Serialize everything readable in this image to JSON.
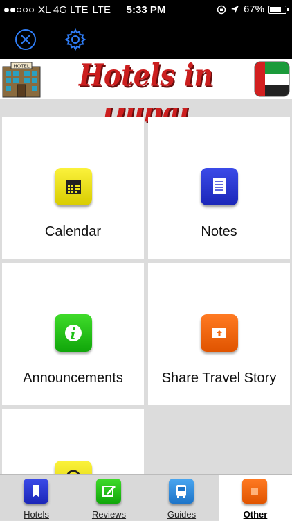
{
  "status_bar": {
    "carrier": "XL 4G LTE",
    "network": "LTE",
    "time": "5:33 PM",
    "battery": "67%",
    "signal_dots_filled": 2,
    "signal_dots_total": 5
  },
  "toolbar": {
    "close_icon": "close-circle-icon",
    "settings_icon": "gear-icon"
  },
  "banner": {
    "title": "Hotels in Dubai",
    "hotel_sign": "HOTEL"
  },
  "tiles": [
    {
      "label": "Calendar",
      "icon": "calendar-icon",
      "color": "#f1e81a"
    },
    {
      "label": "Notes",
      "icon": "notes-icon",
      "color": "#2a36d2"
    },
    {
      "label": "Announcements",
      "icon": "info-icon",
      "color": "#1fc016"
    },
    {
      "label": "Share Travel Story",
      "icon": "share-photo-icon",
      "color": "#f36a10"
    },
    {
      "label": "",
      "icon": "at-sign-icon",
      "color": "#f1e81a"
    }
  ],
  "tab_bar": {
    "tabs": [
      {
        "label": "Hotels",
        "icon": "bookmark-icon",
        "color": "#2a36d2"
      },
      {
        "label": "Reviews",
        "icon": "edit-icon",
        "color": "#1fc016"
      },
      {
        "label": "Guides",
        "icon": "bus-icon",
        "color": "#2f8ee0"
      },
      {
        "label": "Other",
        "icon": "square-icon",
        "color": "#f36a10",
        "active": true
      }
    ]
  }
}
